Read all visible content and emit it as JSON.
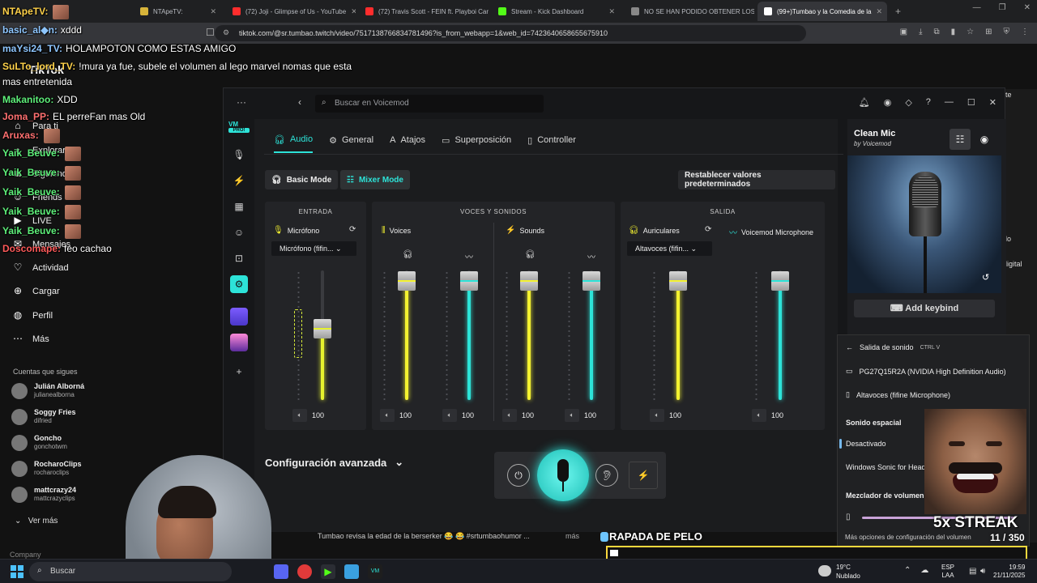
{
  "browser": {
    "tabs": [
      {
        "label": "NTApeTV:",
        "active": false,
        "color": "#d7b43a"
      },
      {
        "label": "(72) Joji - Glimpse of Us - YouTube",
        "active": false,
        "color": "#ff2d2d"
      },
      {
        "label": "(72) Travis Scott - FEIN ft. Playboi Car",
        "active": false,
        "color": "#ff2d2d"
      },
      {
        "label": "Stream - Kick Dashboard",
        "active": false,
        "color": "#53fc18"
      },
      {
        "label": "NO SE HAN PODIDO OBTENER LOS",
        "active": false,
        "color": "#888888"
      },
      {
        "label": "(99+)Tumbao y la Comedia de la",
        "active": true,
        "color": "#ffffff"
      }
    ],
    "url": "tiktok.com/@sr.tumbao.twitch/video/7517138766834781496?is_from_webapp=1&web_id=7423640658655675910"
  },
  "chat": [
    {
      "user": "NTApeTV:",
      "msg": "",
      "color": "#ffd24a",
      "emote": true
    },
    {
      "user": "basic_al◆n:",
      "msg": "xddd",
      "color": "#8ec6ff",
      "emote": false
    },
    {
      "user": "maYsi24_TV:",
      "msg": "HOLAMPOTON COMO ESTAS AMIGO",
      "color": "#8ec6ff",
      "emote": false
    },
    {
      "user": "SuLTo_lord_TV:",
      "msg": "!mura ya fue, subele el volumen al lego marvel nomas que esta",
      "color": "#ffd24a",
      "emote": false
    },
    {
      "user": "",
      "msg": "mas entretenida",
      "color": "#ffffff",
      "emote": false
    },
    {
      "user": "Makanitoo:",
      "msg": "XDD",
      "color": "#5ef07a",
      "emote": false
    },
    {
      "user": "Joma_PP:",
      "msg": "EL perreFan mas Old",
      "color": "#ff7070",
      "emote": false
    },
    {
      "user": "Aruxas:",
      "msg": "",
      "color": "#ff7070",
      "emote": true
    },
    {
      "user": "Yaik_Beuve:",
      "msg": "",
      "color": "#5ef07a",
      "emote": true
    },
    {
      "user": "Yaik_Beuve:",
      "msg": "",
      "color": "#5ef07a",
      "emote": true
    },
    {
      "user": "Yaik_Beuve:",
      "msg": "",
      "color": "#5ef07a",
      "emote": true
    },
    {
      "user": "Yaik_Beuve:",
      "msg": "",
      "color": "#5ef07a",
      "emote": true
    },
    {
      "user": "Yaik_Beuve:",
      "msg": "",
      "color": "#5ef07a",
      "emote": true
    },
    {
      "user": "Doscomape:",
      "msg": "feo cachao",
      "color": "#ff5a5a",
      "emote": false
    }
  ],
  "tiktok": {
    "logo": "TikTok",
    "nav": [
      "Para ti",
      "Explorar",
      "Siguiendo",
      "Friends",
      "LIVE",
      "Mensajes",
      "Actividad",
      "Cargar",
      "Perfil",
      "Más"
    ],
    "following_title": "Cuentas que sigues",
    "accounts": [
      {
        "name": "Julián Alborná",
        "handle": "julianealborna"
      },
      {
        "name": "Soggy Fries",
        "handle": "difried"
      },
      {
        "name": "Goncho",
        "handle": "gonchotwm"
      },
      {
        "name": "RocharoClips",
        "handle": "rocharoclips"
      },
      {
        "name": "mattcrazy24",
        "handle": "mattcrazyclips"
      }
    ],
    "see_more": "Ver más",
    "company": "Company",
    "caption": "Tumbao revisa la edad de la berserker 😂 😂 #srtumbaohumor ...",
    "mas": "más",
    "right_labels": [
      "rte",
      "do",
      "digital"
    ]
  },
  "voicemod": {
    "search_placeholder": "Buscar en Voicemod",
    "tabs": [
      "Audio",
      "General",
      "Atajos",
      "Superposición",
      "Controller"
    ],
    "basic_mode": "Basic Mode",
    "mixer_mode": "Mixer Mode",
    "reset": "Restablecer valores predeterminados",
    "entrada": {
      "title": "ENTRADA",
      "label": "Micrófono",
      "device": "Micrófono (fifin...",
      "volume": "100",
      "level": 0.55
    },
    "voces": {
      "title": "VOCES Y SONIDOS",
      "voices_label": "Voices",
      "sounds_label": "Sounds",
      "channels": [
        {
          "volume": "100",
          "color": "#f4f230",
          "level": 0.92
        },
        {
          "volume": "100",
          "color": "#2de3d8",
          "level": 0.92
        },
        {
          "volume": "100",
          "color": "#f4f230",
          "level": 0.92
        },
        {
          "volume": "100",
          "color": "#2de3d8",
          "level": 0.92
        }
      ]
    },
    "salida": {
      "title": "SALIDA",
      "auriculares_label": "Auriculares",
      "device": "Altavoces (fifin...",
      "vm_mic_label": "Voicemod Microphone",
      "channels": [
        {
          "volume": "100",
          "color": "#f4f230",
          "level": 0.92
        },
        {
          "volume": "100",
          "color": "#2de3d8",
          "level": 0.92
        }
      ]
    },
    "advanced": "Configuración avanzada",
    "preset": {
      "title": "Clean Mic",
      "by": "by Voicemod",
      "keybind": "Add keybind"
    },
    "pro_badge": "PRO!"
  },
  "flyout": {
    "title": "Salida de sonido",
    "shortcut": "CTRL  V",
    "devices": [
      "PG27Q15R2A (NVIDIA High Definition Audio)",
      "Altavoces (fifine Microphone)"
    ],
    "spatial_title": "Sonido espacial",
    "spatial_options": [
      "Desactivado",
      "Windows Sonic for Headphones"
    ],
    "mixer_title": "Mezclador de volumen",
    "more_options": "Más opciones de configuración del volumen"
  },
  "overlay": {
    "streak": "5x STREAK",
    "counter": "11 / 350",
    "rapada": "RAPADA DE PELO",
    "progress": 0.02
  },
  "taskbar": {
    "search": "Buscar",
    "weather_temp": "19°C",
    "weather_desc": "Nublado",
    "lang1": "ESP",
    "lang2": "LAA",
    "time": "19:59",
    "date": "21/11/2025"
  }
}
